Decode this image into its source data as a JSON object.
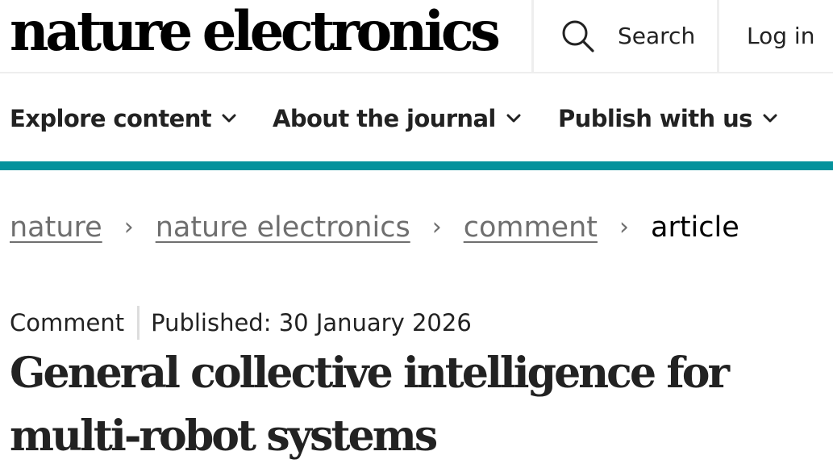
{
  "header": {
    "logo_word1": "nature",
    "logo_word2": "electronics",
    "search_label": "Search",
    "search_icon": "search-icon",
    "login_label": "Log in"
  },
  "nav": {
    "items": [
      {
        "label": "Explore content",
        "icon": "chevron-down-icon"
      },
      {
        "label": "About the journal",
        "icon": "chevron-down-icon"
      },
      {
        "label": "Publish with us",
        "icon": "chevron-down-icon"
      }
    ],
    "accent_color": "#05929c"
  },
  "breadcrumb": {
    "items": [
      "nature",
      "nature electronics",
      "comment"
    ],
    "current": "article",
    "separator": "›"
  },
  "article": {
    "type": "Comment",
    "published_label": "Published: 30 January 2026",
    "title_line1": "General collective intelligence for",
    "title_line2": "multi-robot systems"
  }
}
